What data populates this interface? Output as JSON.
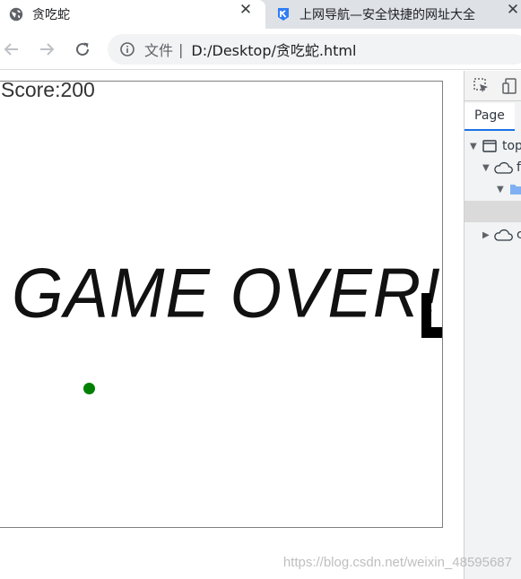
{
  "browser": {
    "tabs": [
      {
        "title": "贪吃蛇",
        "active": true
      },
      {
        "title": "上网导航—安全快捷的网址大全",
        "active": false
      }
    ],
    "omnibox": {
      "scheme_label": "文件",
      "separator": "|",
      "url": "D:/Desktop/贪吃蛇.html"
    }
  },
  "game": {
    "score_text": "Score:200",
    "game_over_text": "GAME OVER!",
    "food_color": "#008000",
    "snake_color": "#000000"
  },
  "devtools": {
    "tab_label": "Page",
    "tree": [
      {
        "label": "top",
        "icon": "frame-icon"
      },
      {
        "label": "f",
        "icon": "cloud-icon"
      },
      {
        "label": "",
        "icon": "folder-icon"
      },
      {
        "label": "c",
        "icon": "cloud-icon"
      }
    ]
  },
  "watermark": "https://blog.csdn.net/weixin_48595687"
}
